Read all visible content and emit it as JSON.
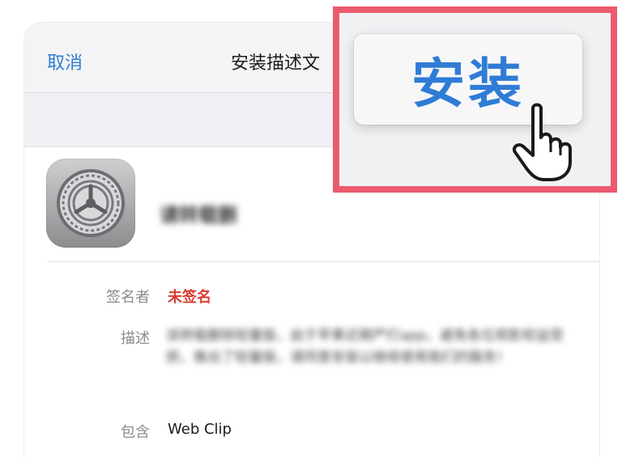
{
  "navbar": {
    "cancel_label": "取消",
    "title": "安装描述文"
  },
  "profile": {
    "name": "请转载删",
    "icon": "settings-gear-icon"
  },
  "details": {
    "signer_label": "签名者",
    "signer_value": "未签名",
    "description_label": "描述",
    "description_value": "该转载删除轻量版，由于苹果近期严打app，避免各位观影权益受损，推出了轻量版，请同意安装以继续使用我们的服务！",
    "contains_label": "包含",
    "contains_value": "Web Clip"
  },
  "install": {
    "label": "安装",
    "highlight_color": "#ec5a6e",
    "pointer_icon": "hand-pointer-icon"
  },
  "colors": {
    "accent": "#2f7cd6",
    "unsigned": "#d93a2f"
  }
}
